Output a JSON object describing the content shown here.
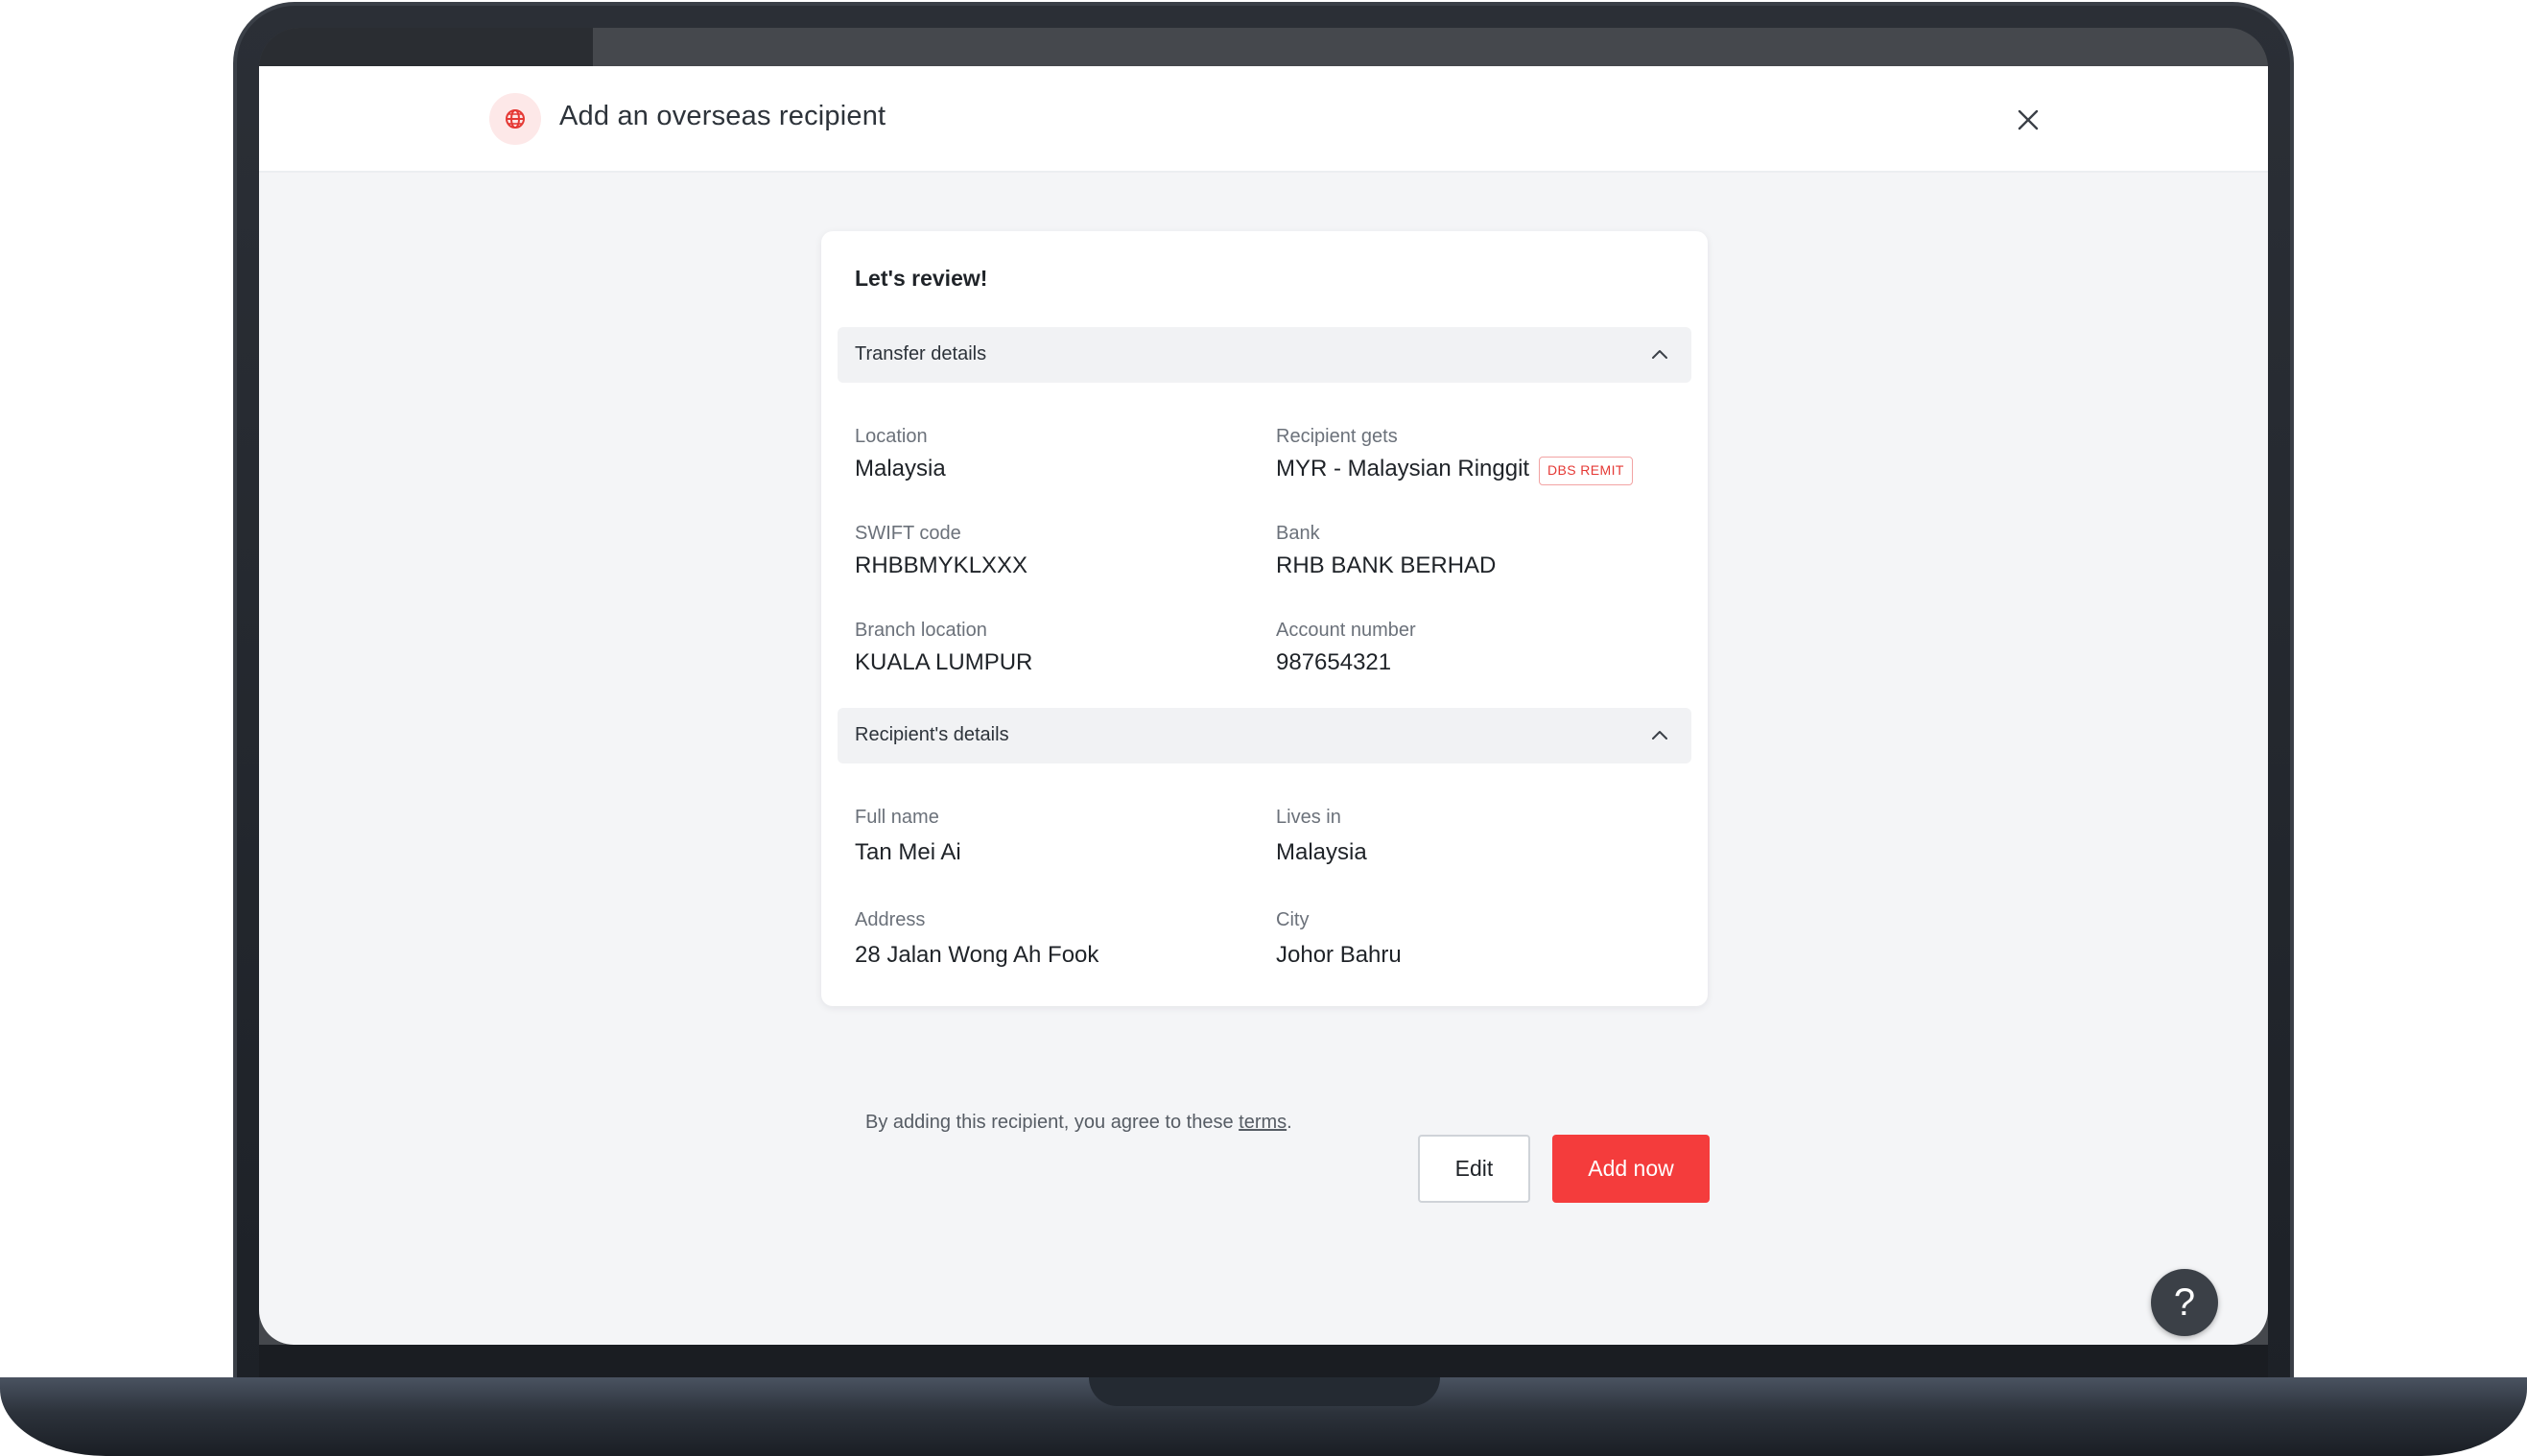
{
  "header": {
    "title": "Add an overseas recipient",
    "icon": "globe-icon",
    "close_icon": "close-icon"
  },
  "review": {
    "title": "Let's review!",
    "transfer_section": {
      "label": "Transfer details",
      "fields": {
        "location_label": "Location",
        "location_value": "Malaysia",
        "recipient_gets_label": "Recipient gets",
        "recipient_gets_value": "MYR - Malaysian Ringgit",
        "badge": "DBS REMIT",
        "swift_label": "SWIFT code",
        "swift_value": "RHBBMYKLXXX",
        "bank_label": "Bank",
        "bank_value": "RHB BANK BERHAD",
        "branch_label": "Branch location",
        "branch_value": "KUALA LUMPUR",
        "account_label": "Account number",
        "account_value": "987654321"
      }
    },
    "recipient_section": {
      "label": "Recipient's details",
      "fields": {
        "full_name_label": "Full name",
        "full_name_value": "Tan Mei Ai",
        "lives_in_label": "Lives in",
        "lives_in_value": "Malaysia",
        "address_label": "Address",
        "address_value": "28 Jalan Wong Ah Fook",
        "city_label": "City",
        "city_value": "Johor Bahru"
      }
    }
  },
  "terms": {
    "prefix": "By adding this recipient, you agree to these ",
    "link": "terms",
    "suffix": "."
  },
  "actions": {
    "edit_label": "Edit",
    "add_label": "Add now"
  },
  "help": {
    "label": "?"
  },
  "colors": {
    "accent": "#f43c3c",
    "badge": "#e53935"
  }
}
